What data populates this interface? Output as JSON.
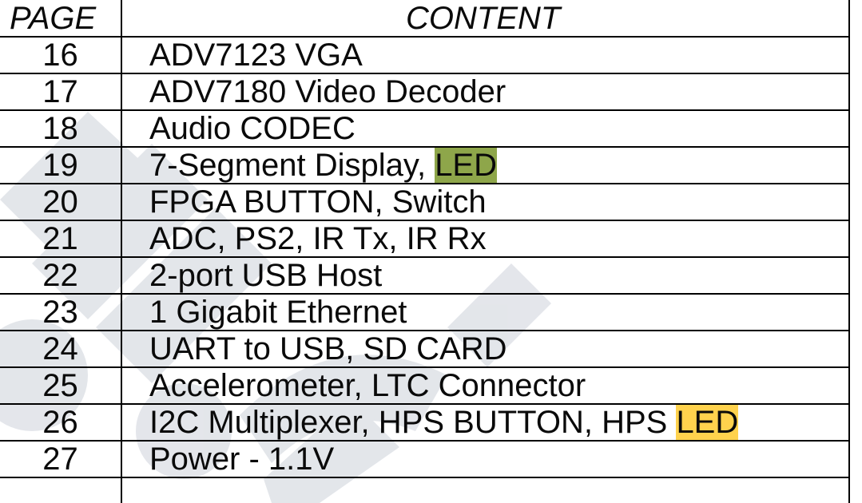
{
  "table": {
    "headers": {
      "page": "PAGE",
      "content": "CONTENT"
    },
    "rows": [
      {
        "page": "16",
        "content": "ADV7123 VGA"
      },
      {
        "page": "17",
        "content": "ADV7180 Video Decoder"
      },
      {
        "page": "18",
        "content": "Audio CODEC"
      },
      {
        "page": "19",
        "content": "7-Segment Display, ",
        "highlight": "LED",
        "highlight_color": "#8ea64a"
      },
      {
        "page": "20",
        "content": "FPGA BUTTON, Switch"
      },
      {
        "page": "21",
        "content": "ADC, PS2, IR Tx, IR Rx"
      },
      {
        "page": "22",
        "content": "2-port USB Host"
      },
      {
        "page": "23",
        "content": "1 Gigabit Ethernet"
      },
      {
        "page": "24",
        "content": "UART to USB, SD CARD"
      },
      {
        "page": "25",
        "content": "Accelerometer, LTC Connector"
      },
      {
        "page": "26",
        "content": "I2C Multiplexer, HPS BUTTON, HPS ",
        "highlight": "LED",
        "highlight_color": "#ffd24d"
      },
      {
        "page": "27",
        "content": "Power - 1.1V"
      }
    ]
  },
  "colors": {
    "text": "#0a0a0a",
    "rule": "#000000",
    "watermark": "#cfd4dc"
  }
}
